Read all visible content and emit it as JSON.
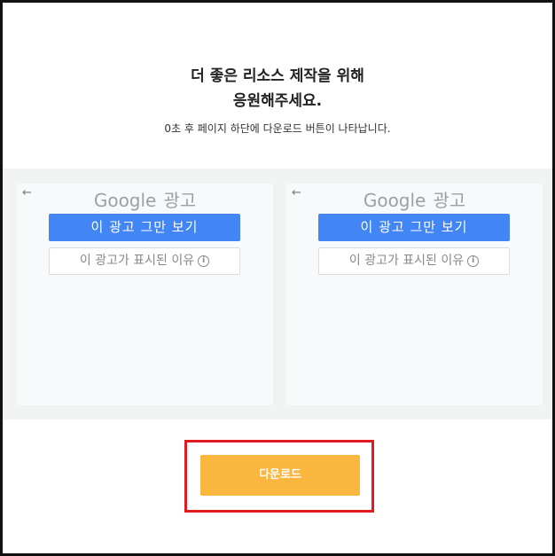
{
  "header": {
    "title_line1": "더 좋은 리소스 제작을 위해",
    "title_line2": "응원해주세요.",
    "subtitle": "0초 후 페이지 하단에 다운로드 버튼이 나타납니다."
  },
  "ads": [
    {
      "back_icon": "←",
      "logo_google": "Google",
      "logo_ad": "광고",
      "stop_label": "이 광고 그만 보기",
      "why_label": "이 광고가 표시된 이유",
      "info_icon": "i"
    },
    {
      "back_icon": "←",
      "logo_google": "Google",
      "logo_ad": "광고",
      "stop_label": "이 광고 그만 보기",
      "why_label": "이 광고가 표시된 이유",
      "info_icon": "i"
    }
  ],
  "download": {
    "label": "다운로드"
  },
  "colors": {
    "download_button": "#fbb63f",
    "highlight_border": "#e11b22",
    "ad_primary_button": "#4285f4"
  }
}
